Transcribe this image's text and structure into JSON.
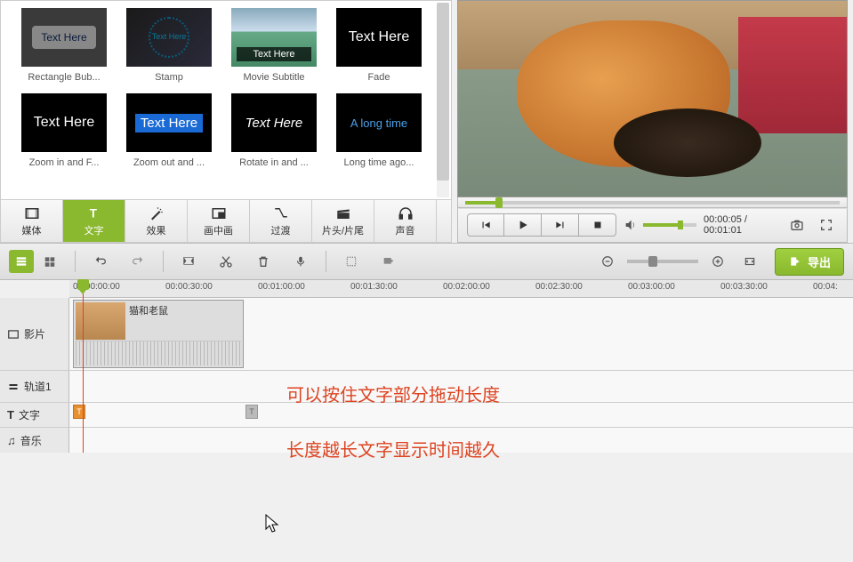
{
  "effects": {
    "items": [
      {
        "label": "Rectangle Bub...",
        "kind": "bubble",
        "text": "Text Here"
      },
      {
        "label": "Stamp",
        "kind": "stamp",
        "text": "Text Here"
      },
      {
        "label": "Movie Subtitle",
        "kind": "movie",
        "text": "Text Here"
      },
      {
        "label": "Fade",
        "kind": "fade",
        "text": "Text Here"
      },
      {
        "label": "Zoom in and F...",
        "kind": "zoomin",
        "text": "Text Here"
      },
      {
        "label": "Zoom out and ...",
        "kind": "zoomout",
        "text": "Text Here"
      },
      {
        "label": "Rotate in and ...",
        "kind": "rotate",
        "text": "Text Here"
      },
      {
        "label": "Long time ago...",
        "kind": "longtime",
        "text": "A long time"
      }
    ]
  },
  "tabs": {
    "media": "媒体",
    "text": "文字",
    "effects": "效果",
    "pip": "画中画",
    "transition": "过渡",
    "intro": "片头/片尾",
    "sound": "声音"
  },
  "player": {
    "current": "00:00:05",
    "total": "00:01:01"
  },
  "export_label": "导出",
  "ruler_ticks": [
    "00:00:00:00",
    "00:00:30:00",
    "00:01:00:00",
    "00:01:30:00",
    "00:02:00:00",
    "00:02:30:00",
    "00:03:00:00",
    "00:03:30:00",
    "00:04:"
  ],
  "tracks": {
    "video": "影片",
    "track2": "轨道1",
    "text": "文字",
    "music": "音乐"
  },
  "clip": {
    "title": "猫和老鼠"
  },
  "annotations": {
    "line1": "可以按住文字部分拖动长度",
    "line2": "长度越长文字显示时间越久"
  },
  "text_markers": {
    "glyph": "T"
  }
}
